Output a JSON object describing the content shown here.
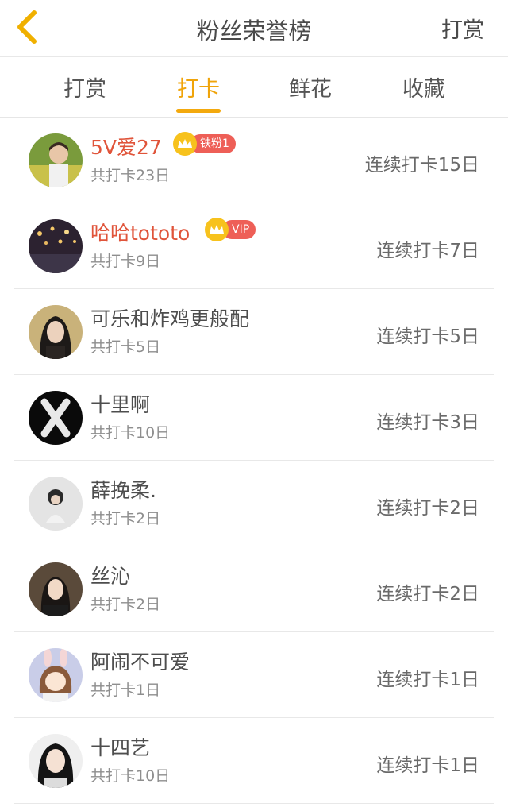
{
  "header": {
    "title": "粉丝荣誉榜",
    "action": "打赏"
  },
  "tabs": [
    "打赏",
    "打卡",
    "鲜花",
    "收藏"
  ],
  "colors": {
    "accent": "#f3a90e",
    "highlight_name": "#e0543a",
    "badge": "#ee5f57",
    "crown": "#f7c21d"
  },
  "rows": [
    {
      "name": "5V爱27",
      "count": "共打卡23日",
      "streak": "连续打卡15日",
      "badge": "铁粉1"
    },
    {
      "name": "哈哈tototo",
      "count": "共打卡9日",
      "streak": "连续打卡7日",
      "badge": "VIP"
    },
    {
      "name": "可乐和炸鸡更般配",
      "count": "共打卡5日",
      "streak": "连续打卡5日"
    },
    {
      "name": "十里啊",
      "count": "共打卡10日",
      "streak": "连续打卡3日"
    },
    {
      "name": "薛挽柔.",
      "count": "共打卡2日",
      "streak": "连续打卡2日"
    },
    {
      "name": "丝沁",
      "count": "共打卡2日",
      "streak": "连续打卡2日"
    },
    {
      "name": "阿闹不可爱",
      "count": "共打卡1日",
      "streak": "连续打卡1日"
    },
    {
      "name": "十四艺",
      "count": "共打卡10日",
      "streak": "连续打卡1日"
    }
  ]
}
